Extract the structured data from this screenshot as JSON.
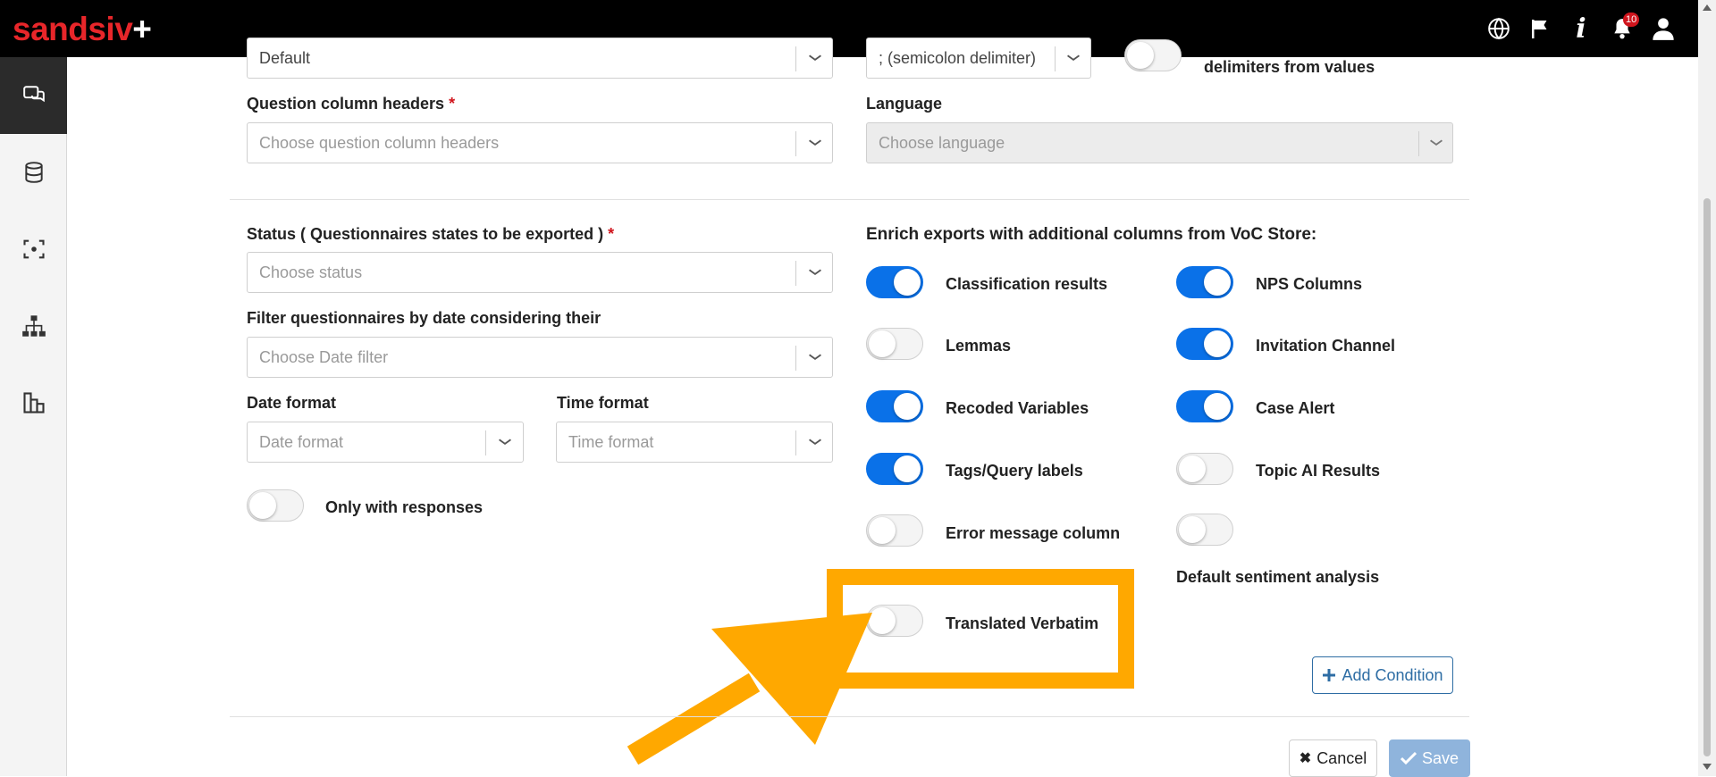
{
  "app": {
    "logo_text": "sandsiv",
    "logo_plus": "+",
    "notification_count": "10"
  },
  "topbar_icons": [
    "globe-icon",
    "flag-icon",
    "info-icon",
    "bell-icon",
    "user-icon"
  ],
  "sidebar_icons": [
    "chat-icon",
    "database-icon",
    "scan-icon",
    "org-chart-icon",
    "bar-chart-icon"
  ],
  "form": {
    "top_select_value": "Default",
    "delimiter_value": "; (semicolon delimiter)",
    "delimiters_label": "delimiters from values",
    "question_headers": {
      "label": "Question column headers",
      "required": "*",
      "placeholder": "Choose question column headers"
    },
    "language": {
      "label": "Language",
      "placeholder": "Choose language"
    },
    "status": {
      "label": "Status ( Questionnaires states to be exported )",
      "required": "*",
      "placeholder": "Choose status"
    },
    "date_filter": {
      "label": "Filter questionnaires by date considering their",
      "placeholder": "Choose Date filter"
    },
    "date_format": {
      "label": "Date format",
      "placeholder": "Date format"
    },
    "time_format": {
      "label": "Time format",
      "placeholder": "Time format"
    },
    "only_responses": {
      "label": "Only with responses",
      "on": false
    }
  },
  "enrich": {
    "title": "Enrich exports with additional columns from VoC Store:",
    "left": [
      {
        "label": "Classification results",
        "on": true
      },
      {
        "label": "Lemmas",
        "on": false
      },
      {
        "label": "Recoded Variables",
        "on": true
      },
      {
        "label": "Tags/Query labels",
        "on": true
      },
      {
        "label": "Error message column",
        "on": false
      },
      {
        "label": "Translated Verbatim",
        "on": false
      }
    ],
    "right": [
      {
        "label": "NPS Columns",
        "on": true
      },
      {
        "label": "Invitation Channel",
        "on": true
      },
      {
        "label": "Case Alert",
        "on": true
      },
      {
        "label": "Topic AI Results",
        "on": false
      },
      {
        "label": "",
        "on": false
      }
    ],
    "default_sentiment_label": "Default sentiment analysis"
  },
  "buttons": {
    "add_condition": "Add Condition",
    "cancel": "Cancel",
    "save": "Save"
  },
  "colors": {
    "toggle_on": "#0a71e8",
    "highlight": "#ffa800",
    "brand_red": "#e8262a"
  }
}
